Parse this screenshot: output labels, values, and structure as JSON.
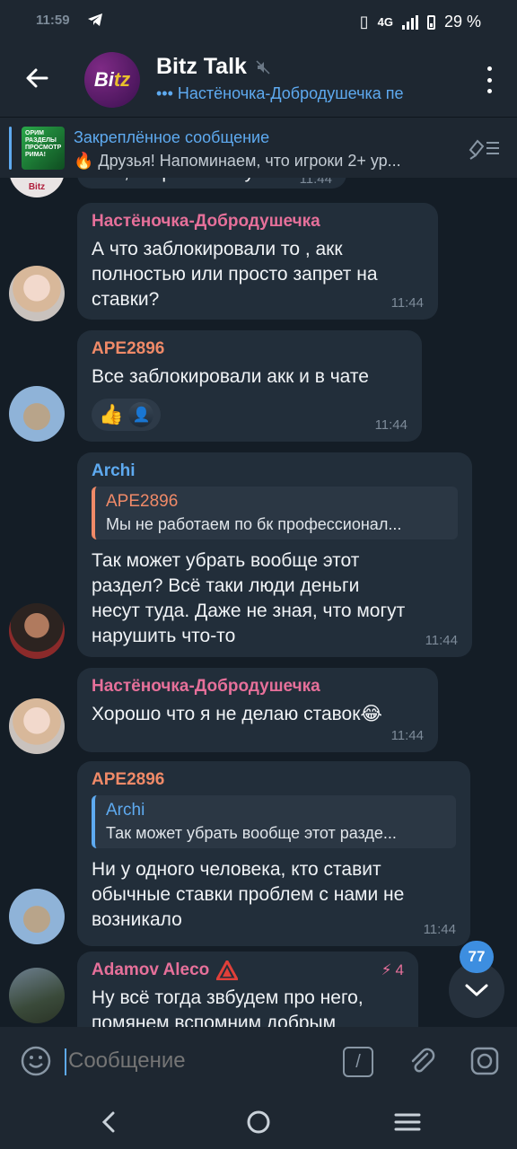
{
  "status": {
    "time": "11:59",
    "network": "4G",
    "battery": "29 %"
  },
  "header": {
    "title": "Bitz Talk",
    "avatar_text_a": "Bi",
    "avatar_text_b": "tz",
    "subtitle": "••• Настёночка-Добродушечка пе"
  },
  "pinned": {
    "title": "Закреплённое сообщение",
    "text": "🔥 Друзья! Напоминаем, что игроки 2+ ур...",
    "thumb_text": "ОРИМ РАЗДЕЛЫ ПРОСМОТР РИМА!"
  },
  "messages": [
    {
      "sender": "Настёночка-Добродушечка",
      "text": "А что заблокировали то , акк полностью или просто запрет на ставки?",
      "time": "11:44"
    },
    {
      "sender": "APE2896",
      "text": "Все заблокировали акк и в чате",
      "time": "11:44",
      "reaction": "👍"
    },
    {
      "sender": "Archi",
      "reply_name": "APE2896",
      "reply_text": "Мы не работаем по бк профессионал...",
      "text": "Так может убрать вообще этот раздел? Всё таки люди деньги несут туда. Даже не зная, что могут нарушить что-то",
      "time": "11:44"
    },
    {
      "sender": "Настёночка-Добродушечка",
      "text": "Хорошо что я не делаю ставок😂",
      "time": "11:44"
    },
    {
      "sender": "APE2896",
      "reply_name": "Archi",
      "reply_text": "Так может убрать вообще этот разде...",
      "text": "Ни у одного человека, кто ставит обычные ставки проблем с нами не возникало",
      "time": "11:44"
    },
    {
      "sender": "Adamov Aleco",
      "badge": "4",
      "text": "Ну всё тогда звбудем про него, помянем вспомним добрым"
    }
  ],
  "partial_top": {
    "text": "Все, закрыли тему!",
    "time": "11:44"
  },
  "unread_count": "77",
  "input": {
    "placeholder": "Сообщение"
  },
  "colors": {
    "accent": "#5eaaf0",
    "sender_pink": "#e6709a",
    "sender_orange": "#f08a68",
    "sender_blue": "#5eaaf0",
    "bubble": "#222e3a",
    "background": "#141d26"
  },
  "icons": [
    "back-arrow-icon",
    "mute-icon",
    "more-icon",
    "unpin-icon",
    "emoji-icon",
    "command-icon",
    "attach-icon",
    "camera-icon",
    "chevron-down-icon",
    "nav-back-icon",
    "nav-home-icon",
    "nav-recents-icon"
  ]
}
